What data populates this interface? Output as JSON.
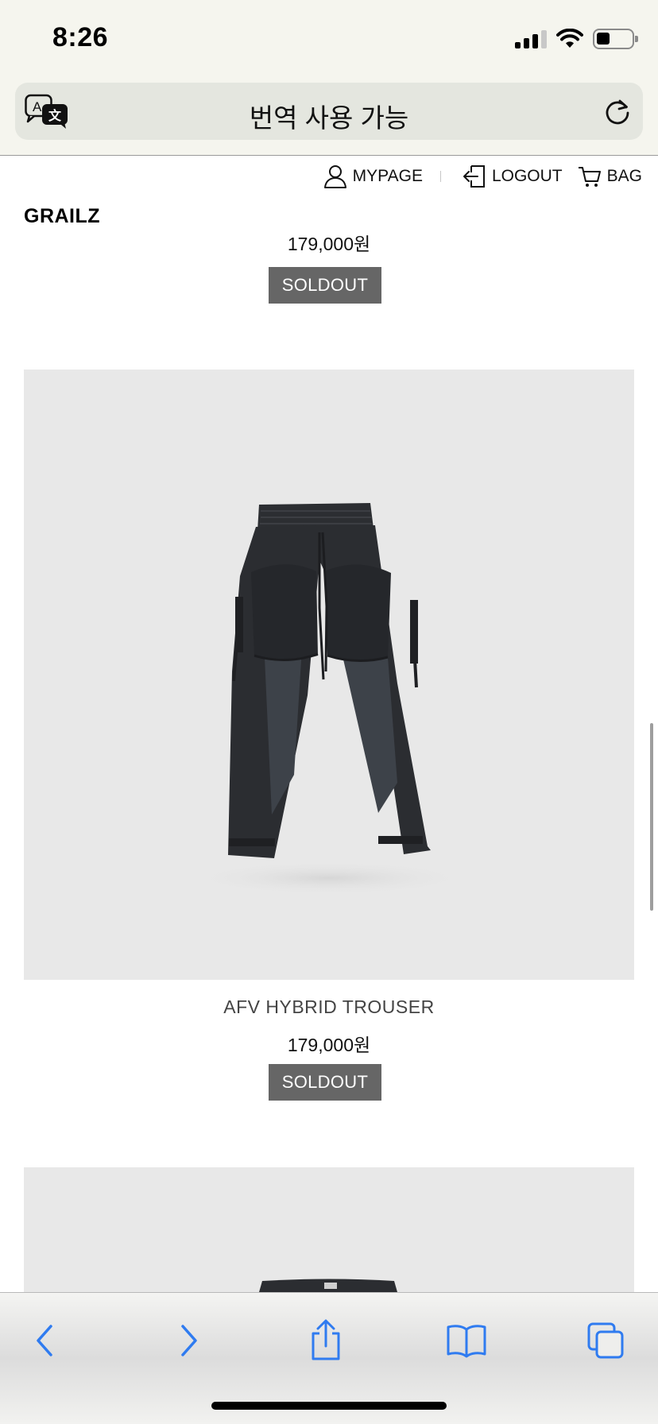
{
  "status_bar": {
    "time": "8:26",
    "battery_level": 0.35,
    "signal_bars": 3
  },
  "address_bar": {
    "text": "번역 사용 가능"
  },
  "top_nav": {
    "mypage": "MYPAGE",
    "logout": "LOGOUT",
    "bag": "BAG"
  },
  "brand": "GRAILZ",
  "products": [
    {
      "price": "179,000원",
      "status": "SOLDOUT"
    },
    {
      "name": "AFV HYBRID TROUSER",
      "price": "179,000원",
      "status": "SOLDOUT"
    }
  ],
  "icons": {
    "translate": "translate-icon",
    "reload": "reload-icon",
    "mypage": "user-icon",
    "logout": "logout-icon",
    "bag": "cart-icon",
    "back": "chevron-left-icon",
    "forward": "chevron-right-icon",
    "share": "share-icon",
    "bookmarks": "book-icon",
    "tabs": "tabs-icon"
  },
  "colors": {
    "accent": "#2f7bf0",
    "soldout_bg": "#666666",
    "image_bg": "#e8e8e8"
  }
}
